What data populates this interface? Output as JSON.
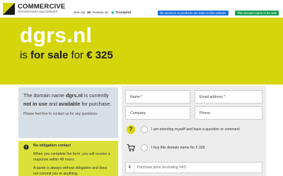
{
  "brand": {
    "name": "COMMERCIVE",
    "tagline": "domeinnaam specialisten"
  },
  "trust": {
    "prefix": "See our",
    "count": "36",
    "suffix": "reviews on",
    "platform": "Trustpilot"
  },
  "badges": {
    "notice": "No services or products are sold on this website.",
    "for_sale": "This domain name is for sale"
  },
  "hero": {
    "domain": "dgrs.nl",
    "sale_prefix": "is ",
    "sale_bold": "for sale",
    "sale_mid": " for ",
    "sale_price": "€ 325"
  },
  "info": {
    "line_a": "The domain name ",
    "domain": "dgrs.nl",
    "line_b": " is currently ",
    "not_in_use": "not in use",
    "line_c": " and ",
    "available": "available",
    "line_d": " for purchase.",
    "contact": "Please feel free to contact us for any questions."
  },
  "obligation": {
    "title": "No obligation contact",
    "body": "When you complete the form, you will receive a response within 48 hours.",
    "body2": "A quote is always without obligation and does not commit you to anything."
  },
  "form": {
    "name": "Name *",
    "email": "Email address *",
    "company": "Company",
    "phone": "Phone",
    "option_question": "I am orienting myself and have a question or comment",
    "option_buy": "I buy this domain name for € 325",
    "currency": "€",
    "price_placeholder": "Purchase price (excluding VAT)"
  },
  "colors": {
    "accent": "#d4d60a",
    "panel_blue": "#d7dfe6",
    "panel_yellow": "#dce13a",
    "badge_blue": "#1c6fd9",
    "badge_green": "#169f52",
    "trustpilot": "#00b67a"
  }
}
